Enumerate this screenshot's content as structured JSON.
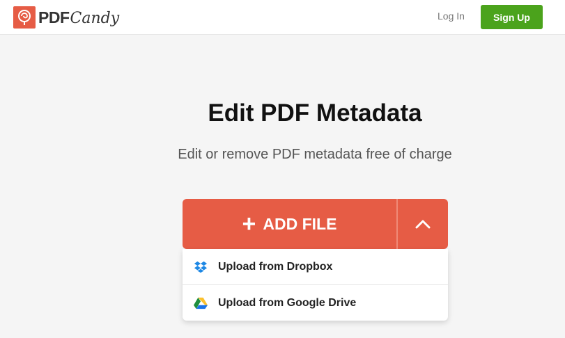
{
  "header": {
    "logo_pdf": "PDF",
    "logo_candy": "Candy",
    "login_label": "Log In",
    "signup_label": "Sign Up"
  },
  "main": {
    "title": "Edit PDF Metadata",
    "subtitle": "Edit or remove PDF metadata free of charge",
    "add_file_plus": "+",
    "add_file_label": "ADD FILE"
  },
  "dropdown": {
    "items": [
      {
        "label": "Upload from Dropbox",
        "icon": "dropbox-icon"
      },
      {
        "label": "Upload from Google Drive",
        "icon": "google-drive-icon"
      }
    ]
  },
  "colors": {
    "brand": "#e65c45",
    "signup": "#4ba31c",
    "background": "#f5f5f5",
    "dropbox": "#1e88e5"
  }
}
